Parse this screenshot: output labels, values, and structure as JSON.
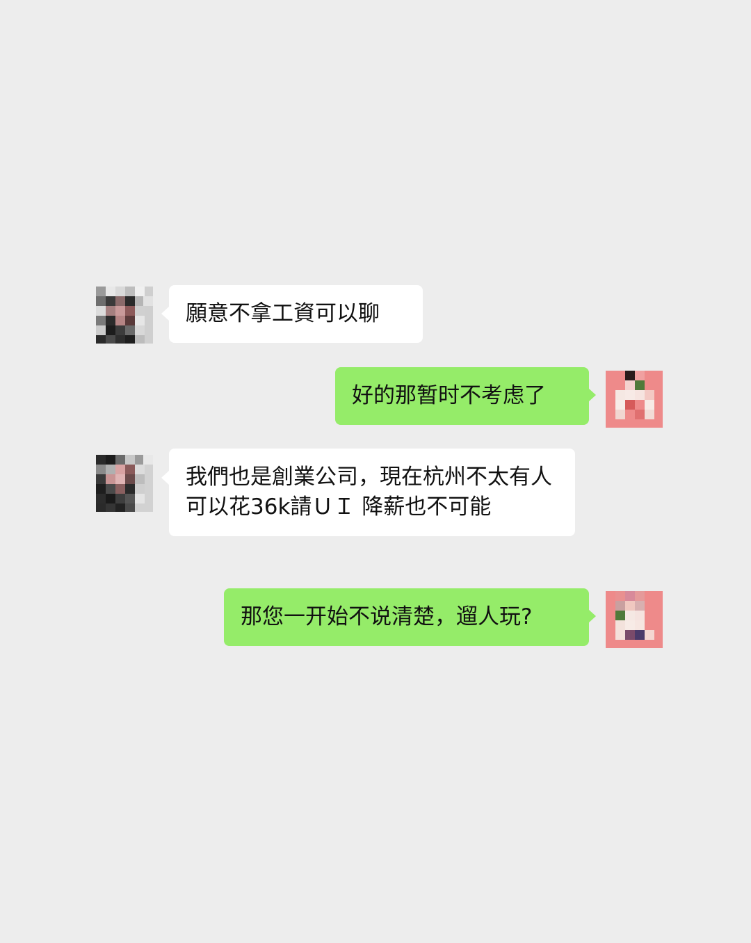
{
  "colors": {
    "background": "#ededed",
    "incoming_bubble": "#ffffff",
    "outgoing_bubble": "#95ec69",
    "text": "#111111"
  },
  "messages": [
    {
      "direction": "incoming",
      "text": "願意不拿工資可以聊"
    },
    {
      "direction": "outgoing",
      "text": "好的那暂时不考虑了"
    },
    {
      "direction": "incoming",
      "text": "我們也是創業公司，現在杭州不太有人可以花36k請ＵＩ 降薪也不可能"
    },
    {
      "direction": "outgoing",
      "text": "那您一开始不说清楚，遛人玩?"
    }
  ],
  "avatars": {
    "contact": "pixelated-contact-avatar",
    "self": "pixelated-self-avatar"
  }
}
